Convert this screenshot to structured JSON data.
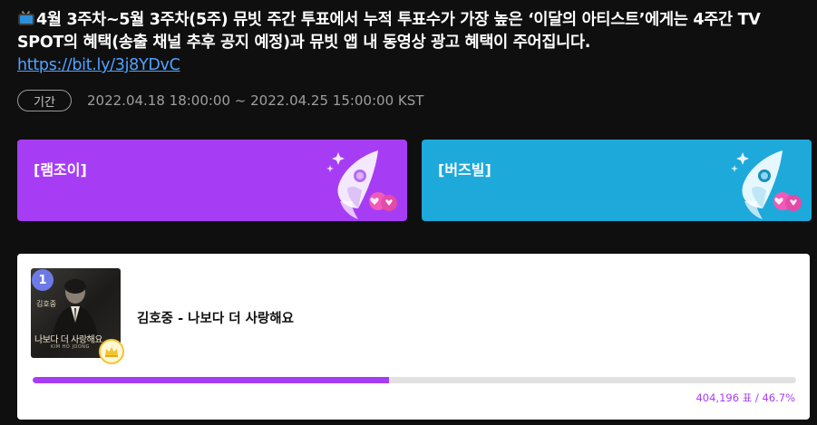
{
  "description": {
    "text": "4월 3주차~5월 3주차(5주) 뮤빗 주간 투표에서 누적 투표수가 가장 높은 ‘이달의 아티스트’에게는 4주간 TV SPOT의 혜택(송출 채널 추후 공지 예정)과 뮤빗 앱 내 동영상 광고 혜택이 주어집니다.",
    "link": "https://bit.ly/3j8YDvC",
    "icon": "tv-icon"
  },
  "period": {
    "chip_label": "기간",
    "dates": "2022.04.18 18:00:00 ~ 2022.04.25 15:00:00 KST"
  },
  "vote_cards": [
    {
      "label": "[램조이]",
      "icon": "rocket-hearts-icon",
      "color": "#a63df5"
    },
    {
      "label": "[버즈빌]",
      "icon": "rocket-hearts-icon",
      "color": "#1ea9db"
    }
  ],
  "ranking": {
    "rank": "1",
    "song": "김호중 - 나보다 더 사랑해요",
    "album_cover_artist": "김호중",
    "album_cover_title": "나보다 더 사랑해요",
    "album_cover_sub": "KIM HO JOONG",
    "crown_icon": "crown-icon",
    "progress_fraction": 0.467,
    "stats": "404,196 표 / 46.7%",
    "accent": "#a63df5"
  }
}
